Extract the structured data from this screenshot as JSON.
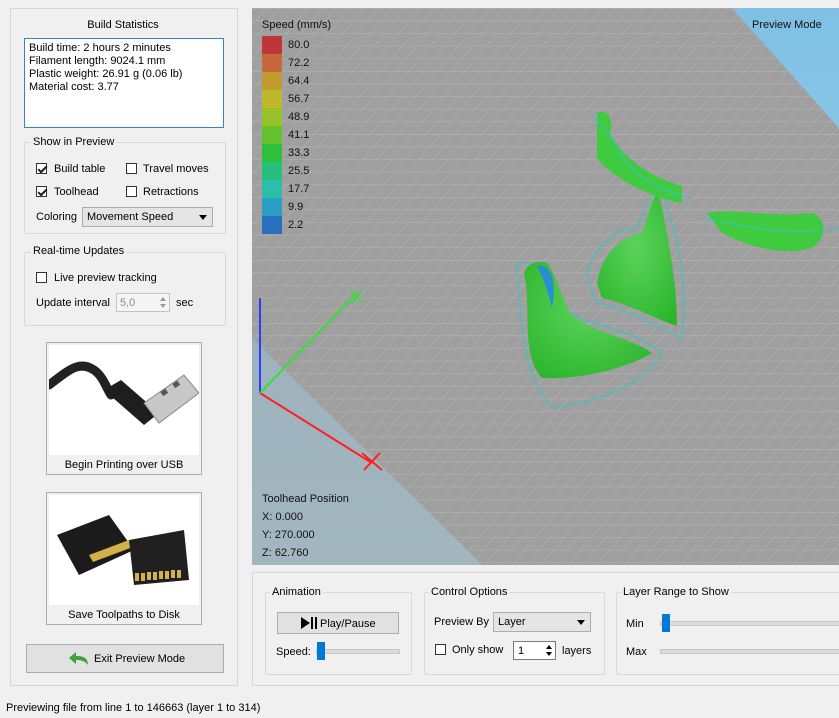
{
  "build_statistics": {
    "title": "Build Statistics",
    "lines": [
      "Build time: 2 hours 2 minutes",
      "Filament length: 9024.1 mm",
      "Plastic weight: 26.91 g (0.06 lb)",
      "Material cost: 3.77"
    ]
  },
  "show_in_preview": {
    "title": "Show in Preview",
    "build_table": {
      "label": "Build table",
      "checked": true
    },
    "travel_moves": {
      "label": "Travel moves",
      "checked": false
    },
    "toolhead": {
      "label": "Toolhead",
      "checked": true
    },
    "retractions": {
      "label": "Retractions",
      "checked": false
    },
    "coloring_label": "Coloring",
    "coloring_value": "Movement Speed"
  },
  "realtime": {
    "title": "Real-time Updates",
    "live_label": "Live preview tracking",
    "interval_label": "Update interval",
    "interval_value": "5,0",
    "interval_unit": "sec"
  },
  "usb": {
    "label": "Begin Printing over USB"
  },
  "disk": {
    "label": "Save Toolpaths to Disk"
  },
  "exit_button": {
    "label": "Exit Preview Mode"
  },
  "viewport": {
    "mode_label": "Preview Mode",
    "legend_title": "Speed (mm/s)",
    "legend": [
      {
        "value": "80.0",
        "color": "#c0343c"
      },
      {
        "value": "72.2",
        "color": "#c5683a"
      },
      {
        "value": "64.4",
        "color": "#c39a2f"
      },
      {
        "value": "56.7",
        "color": "#bfb72c"
      },
      {
        "value": "48.9",
        "color": "#98c22c"
      },
      {
        "value": "41.1",
        "color": "#66c12f"
      },
      {
        "value": "33.3",
        "color": "#2fbe3d"
      },
      {
        "value": "25.5",
        "color": "#27c07a"
      },
      {
        "value": "17.7",
        "color": "#2dbdaa"
      },
      {
        "value": "9.9",
        "color": "#2b9ec4"
      },
      {
        "value": "2.2",
        "color": "#2a6ec0"
      }
    ],
    "toolhead_title": "Toolhead Position",
    "toolhead_x": "X: 0.000",
    "toolhead_y": "Y: 270.000",
    "toolhead_z": "Z: 62.760"
  },
  "animation": {
    "title": "Animation",
    "play_label": "Play/Pause",
    "speed_label": "Speed:"
  },
  "control": {
    "title": "Control Options",
    "preview_by_label": "Preview By",
    "preview_by_value": "Layer",
    "only_show_label": "Only show",
    "only_show_value": "1",
    "layers_label": "layers"
  },
  "layer_range": {
    "title": "Layer Range to Show",
    "min_label": "Min",
    "max_label": "Max"
  },
  "status_bar": {
    "text": "Previewing file from line 1 to 146663 (layer 1 to 314)"
  }
}
